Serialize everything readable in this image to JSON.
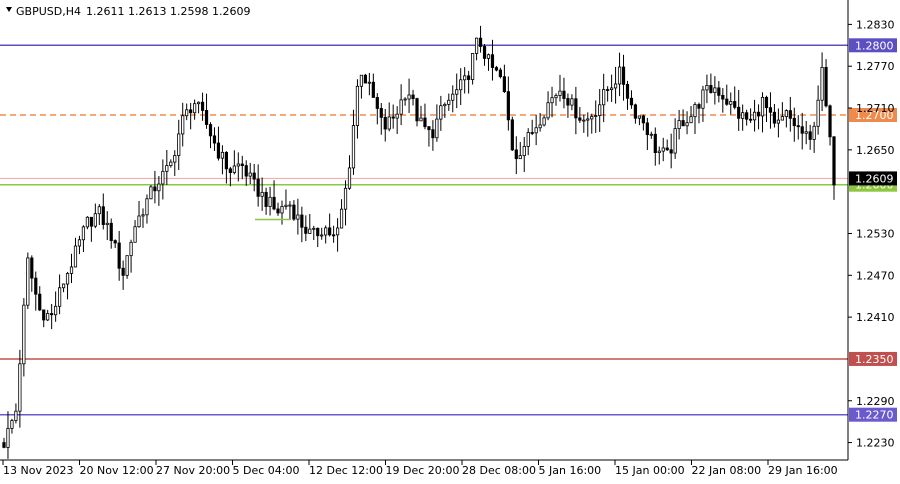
{
  "header": {
    "dropdown_icon": "triangle-down-icon",
    "symbol": "GBPUSD,H4",
    "ohlc": "1.2611 1.2613 1.2598 1.2609"
  },
  "chart_data": {
    "type": "candlestick",
    "symbol": "GBPUSD",
    "timeframe": "H4",
    "last_ohlc": {
      "open": 1.2611,
      "high": 1.2613,
      "low": 1.2598,
      "close": 1.2609
    },
    "current_price": 1.2609,
    "ylim": [
      1.2205,
      1.2865
    ],
    "y_ticks": [
      "1.2830",
      "1.2770",
      "1.2710",
      "1.2650",
      "1.2530",
      "1.2470",
      "1.2410",
      "1.2290",
      "1.2230"
    ],
    "x_ticks": [
      "13 Nov 2023",
      "20 Nov 12:00",
      "27 Nov 20:00",
      "5 Dec 04:00",
      "12 Dec 12:00",
      "19 Dec 20:00",
      "28 Dec 08:00",
      "5 Jan 16:00",
      "15 Jan 00:00",
      "22 Jan 08:00",
      "29 Jan 16:00"
    ],
    "levels": [
      {
        "price": 1.28,
        "label": "1.2800",
        "color": "#5b4fc2",
        "style": "solid"
      },
      {
        "price": 1.27,
        "label": "1.2700",
        "color": "#f08a4b",
        "style": "dashed"
      },
      {
        "price": 1.26,
        "label": "1.2600",
        "color": "#8ec63f",
        "style": "solid"
      },
      {
        "price": 1.235,
        "label": "1.2350",
        "color": "#c0504d",
        "style": "solid"
      },
      {
        "price": 1.227,
        "label": "1.2270",
        "color": "#6a5acd",
        "style": "solid"
      }
    ],
    "trend_close_series": [
      1.223,
      1.2275,
      1.249,
      1.242,
      1.241,
      1.246,
      1.25,
      1.2545,
      1.256,
      1.253,
      1.247,
      1.254,
      1.2575,
      1.2605,
      1.2625,
      1.269,
      1.272,
      1.269,
      1.265,
      1.262,
      1.263,
      1.26,
      1.258,
      1.256,
      1.2575,
      1.2545,
      1.2525,
      1.254,
      1.252,
      1.261,
      1.277,
      1.273,
      1.268,
      1.27,
      1.274,
      1.269,
      1.267,
      1.271,
      1.273,
      1.275,
      1.281,
      1.277,
      1.275,
      1.264,
      1.266,
      1.269,
      1.272,
      1.274,
      1.271,
      1.269,
      1.271,
      1.274,
      1.276,
      1.271,
      1.269,
      1.265,
      1.264,
      1.269,
      1.27,
      1.273,
      1.274,
      1.272,
      1.27,
      1.269,
      1.272,
      1.268,
      1.27,
      1.268,
      1.266,
      1.276,
      1.2609
    ]
  }
}
